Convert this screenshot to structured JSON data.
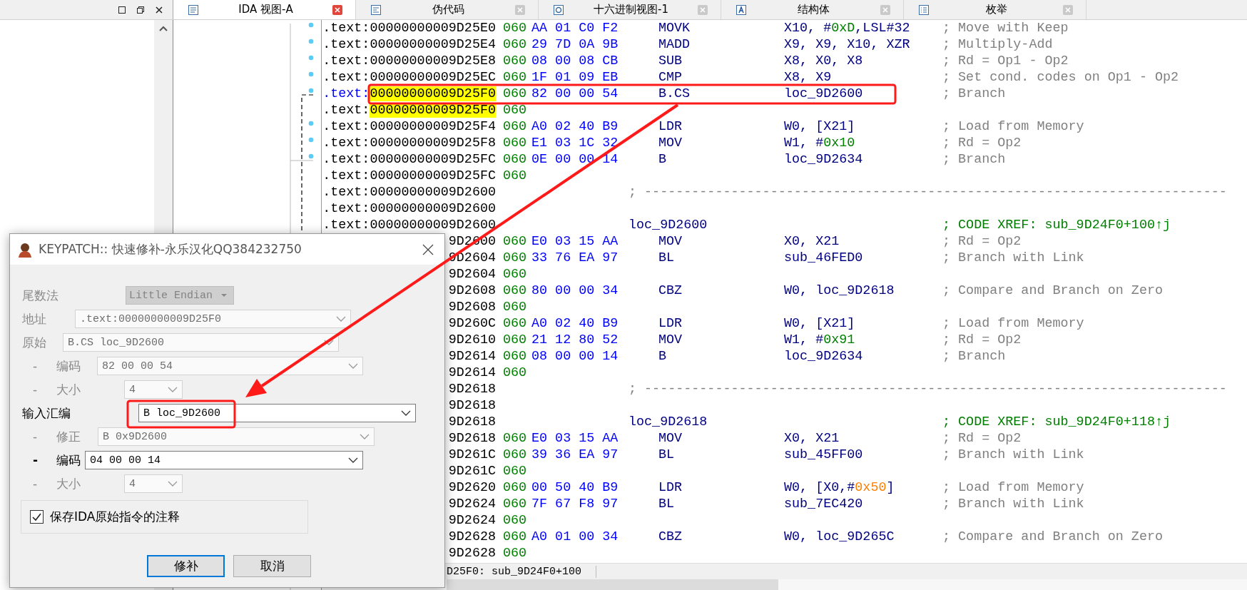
{
  "tabs": [
    {
      "label": "IDA 视图-A",
      "kind": "listing",
      "selected": true
    },
    {
      "label": "伪代码",
      "kind": "pseudocode",
      "selected": false
    },
    {
      "label": "十六进制视图-1",
      "kind": "hex",
      "selected": false
    },
    {
      "label": "结构体",
      "kind": "struct",
      "selected": false
    },
    {
      "label": "枚举",
      "kind": "enum",
      "selected": false
    }
  ],
  "listing": {
    "rows": [
      {
        "kind": "insn",
        "segment": ".text:",
        "address": "00000000009D25E0",
        "sp": "060",
        "bytes": "AA 01 C0 F2",
        "mnemonic": "MOVK",
        "operands": [
          {
            "text": "X10, #",
            "kind": "plain"
          },
          {
            "text": "0xD",
            "kind": "number"
          },
          {
            "text": ",LSL#32",
            "kind": "plain"
          }
        ],
        "comment": "; Move with Keep",
        "current": false,
        "highlighted": false,
        "marker": true
      },
      {
        "kind": "insn",
        "segment": ".text:",
        "address": "00000000009D25E4",
        "sp": "060",
        "bytes": "29 7D 0A 9B",
        "mnemonic": "MADD",
        "operands": [
          {
            "text": "X9, X9, X10, XZR",
            "kind": "plain"
          }
        ],
        "comment": "; Multiply-Add",
        "current": false,
        "highlighted": false,
        "marker": true
      },
      {
        "kind": "insn",
        "segment": ".text:",
        "address": "00000000009D25E8",
        "sp": "060",
        "bytes": "08 00 08 CB",
        "mnemonic": "SUB",
        "operands": [
          {
            "text": "X8, X0, X8",
            "kind": "plain"
          }
        ],
        "comment": "; Rd = Op1 - Op2",
        "current": false,
        "highlighted": false,
        "marker": true
      },
      {
        "kind": "insn",
        "segment": ".text:",
        "address": "00000000009D25EC",
        "sp": "060",
        "bytes": "1F 01 09 EB",
        "mnemonic": "CMP",
        "operands": [
          {
            "text": "X8, X9",
            "kind": "plain"
          }
        ],
        "comment": "; Set cond. codes on Op1 - Op2",
        "current": false,
        "highlighted": false,
        "marker": true
      },
      {
        "kind": "insn",
        "segment": ".text:",
        "address": "00000000009D25F0",
        "sp": "060",
        "bytes": "82 00 00 54",
        "mnemonic": "B.CS",
        "operands": [
          {
            "text": "loc_9D2600",
            "kind": "plain"
          }
        ],
        "comment": "; Branch",
        "current": true,
        "highlighted": true,
        "marker": true
      },
      {
        "kind": "gap",
        "segment": ".text:",
        "address": "00000000009D25F0",
        "sp": "060",
        "current": false,
        "highlighted": true,
        "marker": false
      },
      {
        "kind": "insn",
        "segment": ".text:",
        "address": "00000000009D25F4",
        "sp": "060",
        "bytes": "A0 02 40 B9",
        "mnemonic": "LDR",
        "operands": [
          {
            "text": "W0, [X21]",
            "kind": "plain"
          }
        ],
        "comment": "; Load from Memory",
        "current": false,
        "highlighted": false,
        "marker": true
      },
      {
        "kind": "insn",
        "segment": ".text:",
        "address": "00000000009D25F8",
        "sp": "060",
        "bytes": "E1 03 1C 32",
        "mnemonic": "MOV",
        "operands": [
          {
            "text": "W1, #",
            "kind": "plain"
          },
          {
            "text": "0x10",
            "kind": "number"
          }
        ],
        "comment": "; Rd = Op2",
        "current": false,
        "highlighted": false,
        "marker": true
      },
      {
        "kind": "insn",
        "segment": ".text:",
        "address": "00000000009D25FC",
        "sp": "060",
        "bytes": "0E 00 00 14",
        "mnemonic": "B",
        "operands": [
          {
            "text": "loc_9D2634",
            "kind": "plain"
          }
        ],
        "comment": "; Branch",
        "current": false,
        "highlighted": false,
        "marker": true
      },
      {
        "kind": "gap",
        "segment": ".text:",
        "address": "00000000009D25FC",
        "sp": "060",
        "current": false,
        "highlighted": false,
        "marker": false
      },
      {
        "kind": "separator",
        "segment": ".text:",
        "address": "00000000009D2600",
        "comment": "; --------------------------------------------------------------------------",
        "current": false,
        "highlighted": false,
        "marker": false
      },
      {
        "kind": "blank",
        "segment": ".text:",
        "address": "00000000009D2600",
        "current": false,
        "highlighted": false,
        "marker": false
      },
      {
        "kind": "label",
        "segment": ".text:",
        "address": "00000000009D2600",
        "label": "loc_9D2600",
        "comment": "; CODE XREF: sub_9D24F0+100↑j",
        "current": false,
        "highlighted": false,
        "marker": false
      },
      {
        "kind": "insn",
        "address": "9D2600",
        "sp": "060",
        "bytes": "E0 03 15 AA",
        "mnemonic": "MOV",
        "operands": [
          {
            "text": "X0, X21",
            "kind": "plain"
          }
        ],
        "comment": "; Rd = Op2",
        "highlighted": false
      },
      {
        "kind": "insn",
        "address": "9D2604",
        "sp": "060",
        "bytes": "33 76 EA 97",
        "mnemonic": "BL",
        "operands": [
          {
            "text": "sub_46FED0",
            "kind": "plain"
          }
        ],
        "comment": "; Branch with Link",
        "highlighted": false
      },
      {
        "kind": "gap",
        "address": "9D2604",
        "sp": "060",
        "highlighted": false
      },
      {
        "kind": "insn",
        "address": "9D2608",
        "sp": "060",
        "bytes": "80 00 00 34",
        "mnemonic": "CBZ",
        "operands": [
          {
            "text": "W0, loc_9D2618",
            "kind": "plain"
          }
        ],
        "comment": "; Compare and Branch on Zero",
        "highlighted": false
      },
      {
        "kind": "gap",
        "address": "9D2608",
        "sp": "060",
        "highlighted": false
      },
      {
        "kind": "insn",
        "address": "9D260C",
        "sp": "060",
        "bytes": "A0 02 40 B9",
        "mnemonic": "LDR",
        "operands": [
          {
            "text": "W0, [X21]",
            "kind": "plain"
          }
        ],
        "comment": "; Load from Memory",
        "highlighted": false
      },
      {
        "kind": "insn",
        "address": "9D2610",
        "sp": "060",
        "bytes": "21 12 80 52",
        "mnemonic": "MOV",
        "operands": [
          {
            "text": "W1, #",
            "kind": "plain"
          },
          {
            "text": "0x91",
            "kind": "number"
          }
        ],
        "comment": "; Rd = Op2",
        "highlighted": false
      },
      {
        "kind": "insn",
        "address": "9D2614",
        "sp": "060",
        "bytes": "08 00 00 14",
        "mnemonic": "B",
        "operands": [
          {
            "text": "loc_9D2634",
            "kind": "plain"
          }
        ],
        "comment": "; Branch",
        "highlighted": false
      },
      {
        "kind": "gap",
        "address": "9D2614",
        "sp": "060",
        "highlighted": false
      },
      {
        "kind": "separator",
        "address": "9D2618",
        "comment": "; --------------------------------------------------------------------------",
        "highlighted": false
      },
      {
        "kind": "blank",
        "address": "9D2618",
        "highlighted": false
      },
      {
        "kind": "label",
        "address": "9D2618",
        "label": "loc_9D2618",
        "comment": "; CODE XREF: sub_9D24F0+118↑j",
        "highlighted": false
      },
      {
        "kind": "insn",
        "address": "9D2618",
        "sp": "060",
        "bytes": "E0 03 15 AA",
        "mnemonic": "MOV",
        "operands": [
          {
            "text": "X0, X21",
            "kind": "plain"
          }
        ],
        "comment": "; Rd = Op2",
        "highlighted": false
      },
      {
        "kind": "insn",
        "address": "9D261C",
        "sp": "060",
        "bytes": "39 36 EA 97",
        "mnemonic": "BL",
        "operands": [
          {
            "text": "sub_45FF00",
            "kind": "plain"
          }
        ],
        "comment": "; Branch with Link",
        "highlighted": false
      },
      {
        "kind": "gap",
        "address": "9D261C",
        "sp": "060",
        "highlighted": false
      },
      {
        "kind": "insn",
        "address": "9D2620",
        "sp": "060",
        "bytes": "00 50 40 B9",
        "mnemonic": "LDR",
        "operands": [
          {
            "text": "W0, [X0,#",
            "kind": "plain"
          },
          {
            "text": "0x50",
            "kind": "hot"
          },
          {
            "text": "]",
            "kind": "plain"
          }
        ],
        "comment": "; Load from Memory",
        "highlighted": false
      },
      {
        "kind": "insn",
        "address": "9D2624",
        "sp": "060",
        "bytes": "7F 67 F8 97",
        "mnemonic": "BL",
        "operands": [
          {
            "text": "sub_7EC420",
            "kind": "plain"
          }
        ],
        "comment": "; Branch with Link",
        "highlighted": false
      },
      {
        "kind": "gap",
        "address": "9D2624",
        "sp": "060",
        "highlighted": false
      },
      {
        "kind": "insn",
        "address": "9D2628",
        "sp": "060",
        "bytes": "A0 01 00 34",
        "mnemonic": "CBZ",
        "operands": [
          {
            "text": "W0, loc_9D265C",
            "kind": "plain"
          }
        ],
        "comment": "; Compare and Branch on Zero",
        "highlighted": false
      },
      {
        "kind": "gap",
        "address": "9D2628",
        "sp": "060",
        "highlighted": false
      }
    ]
  },
  "status_bar": {
    "text": "D25F0: sub_9D24F0+100"
  },
  "dialog": {
    "title": "KEYPATCH:: 快速修补-永乐汉化QQ384232750",
    "fields": [
      {
        "kind": "dropdown",
        "label": "尾数法",
        "value": "Little Endian",
        "enabled": false
      },
      {
        "kind": "combo",
        "label": "地址",
        "value": ".text:00000000009D25F0",
        "enabled": false
      },
      {
        "kind": "combo",
        "label": "原始",
        "value": "B.CS loc_9D2600",
        "enabled": false
      },
      {
        "kind": "combo",
        "bullet": "-",
        "label": "编码",
        "value": "82 00 00 54",
        "enabled": false
      },
      {
        "kind": "combo",
        "bullet": "-",
        "label": "大小",
        "value": "4",
        "enabled": false
      },
      {
        "kind": "combo",
        "label": "输入汇编",
        "value": "B loc_9D2600",
        "enabled": true
      },
      {
        "kind": "combo",
        "bullet": "-",
        "label": "修正",
        "value": "B 0x9D2600",
        "enabled": false
      },
      {
        "kind": "combo",
        "bullet": "-",
        "label": "编码",
        "value": "04 00 00 14",
        "enabled": true
      },
      {
        "kind": "combo",
        "bullet": "-",
        "label": "大小",
        "value": "4",
        "enabled": false
      }
    ],
    "checkbox": {
      "label": "保存IDA原始指令的注释",
      "checked": true
    },
    "buttons": [
      {
        "label": "修补",
        "default": true
      },
      {
        "label": "取消",
        "default": false
      }
    ]
  }
}
